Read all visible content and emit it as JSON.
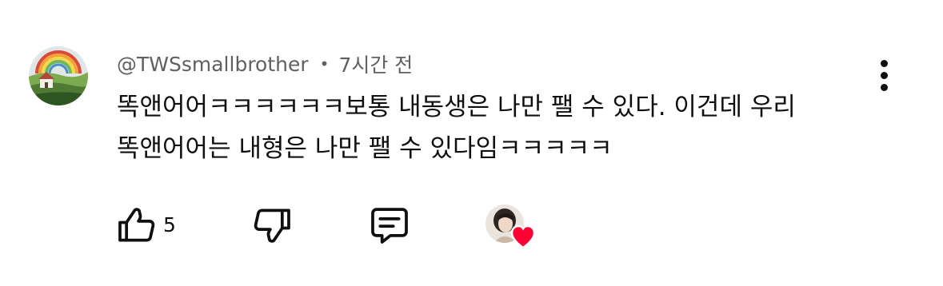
{
  "comment": {
    "author": "@TWSsmallbrother",
    "separator": "•",
    "time": "7시간 전",
    "lines": [
      "똑앤어어ㅋㅋㅋㅋㅋㅋ보통 내동생은 나만 팰 수 있다. 이건데 우리",
      "똑앤어어는 내형은 나만 팰 수 있다임ㅋㅋㅋㅋㅋ"
    ],
    "like_count": "5"
  },
  "icons": {
    "more": "more-vert-icon",
    "like": "thumbs-up-icon",
    "dislike": "thumbs-down-icon",
    "reply": "comment-reply-icon",
    "heart": "heart-icon"
  },
  "colors": {
    "text": "#0f0f0f",
    "secondary_text": "#606060",
    "heart": "#ff0033"
  }
}
